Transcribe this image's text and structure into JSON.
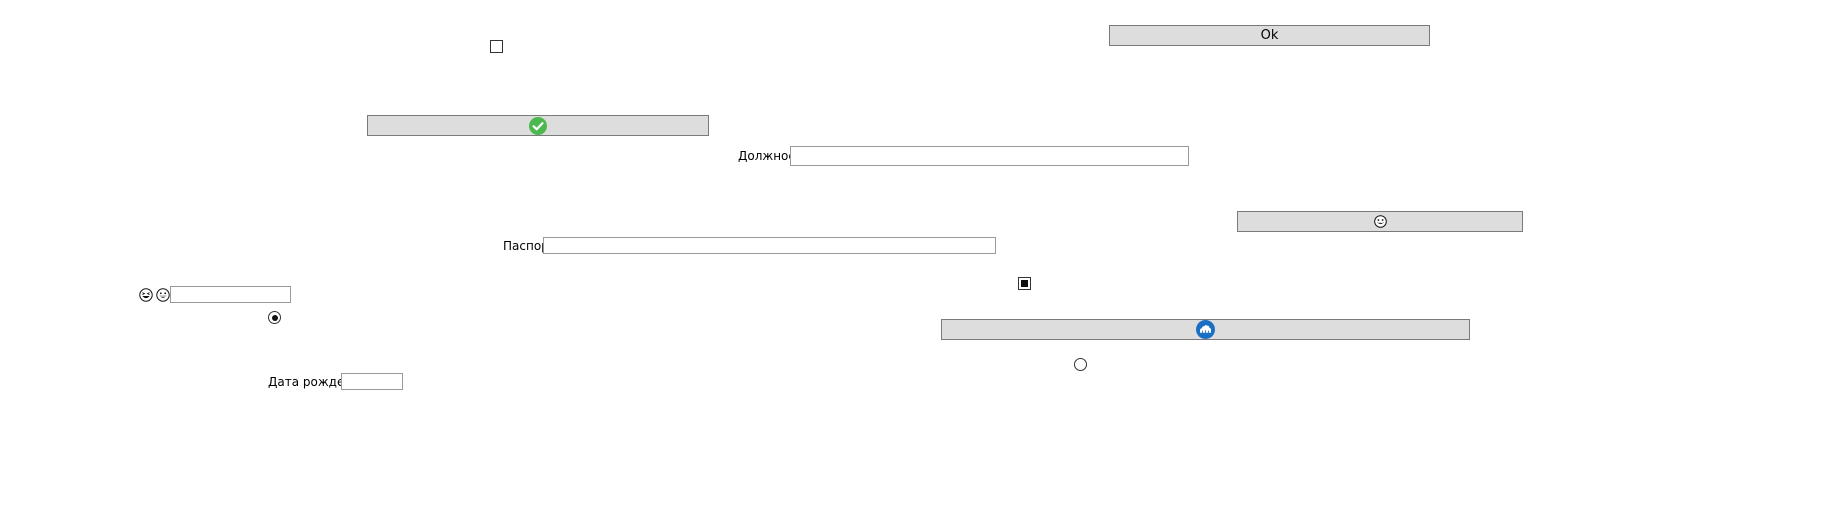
{
  "window": {
    "title": ""
  },
  "buttons": {
    "ok": {
      "label": "Ok"
    },
    "confirm": {
      "icon": "check-circle-icon",
      "color": "#4db84e"
    },
    "emoji": {
      "icon": "grinning-face-icon"
    },
    "cloud": {
      "icon": "cloud-icon",
      "color": "#1a6fc4"
    }
  },
  "checkboxes": {
    "top": {
      "checked": false
    },
    "middle": {
      "checked": true
    }
  },
  "radios": {
    "left": {
      "selected": true
    },
    "right": {
      "selected": false
    }
  },
  "fields": {
    "position": {
      "label": "Должность",
      "value": ""
    },
    "passport": {
      "label": "Паспорт",
      "value": ""
    },
    "emoji_field": {
      "value": "",
      "icons": [
        "grinning-squint-face-icon",
        "grinning-face-icon"
      ]
    },
    "birth_date": {
      "label": "Дата рождения",
      "value": ""
    }
  }
}
